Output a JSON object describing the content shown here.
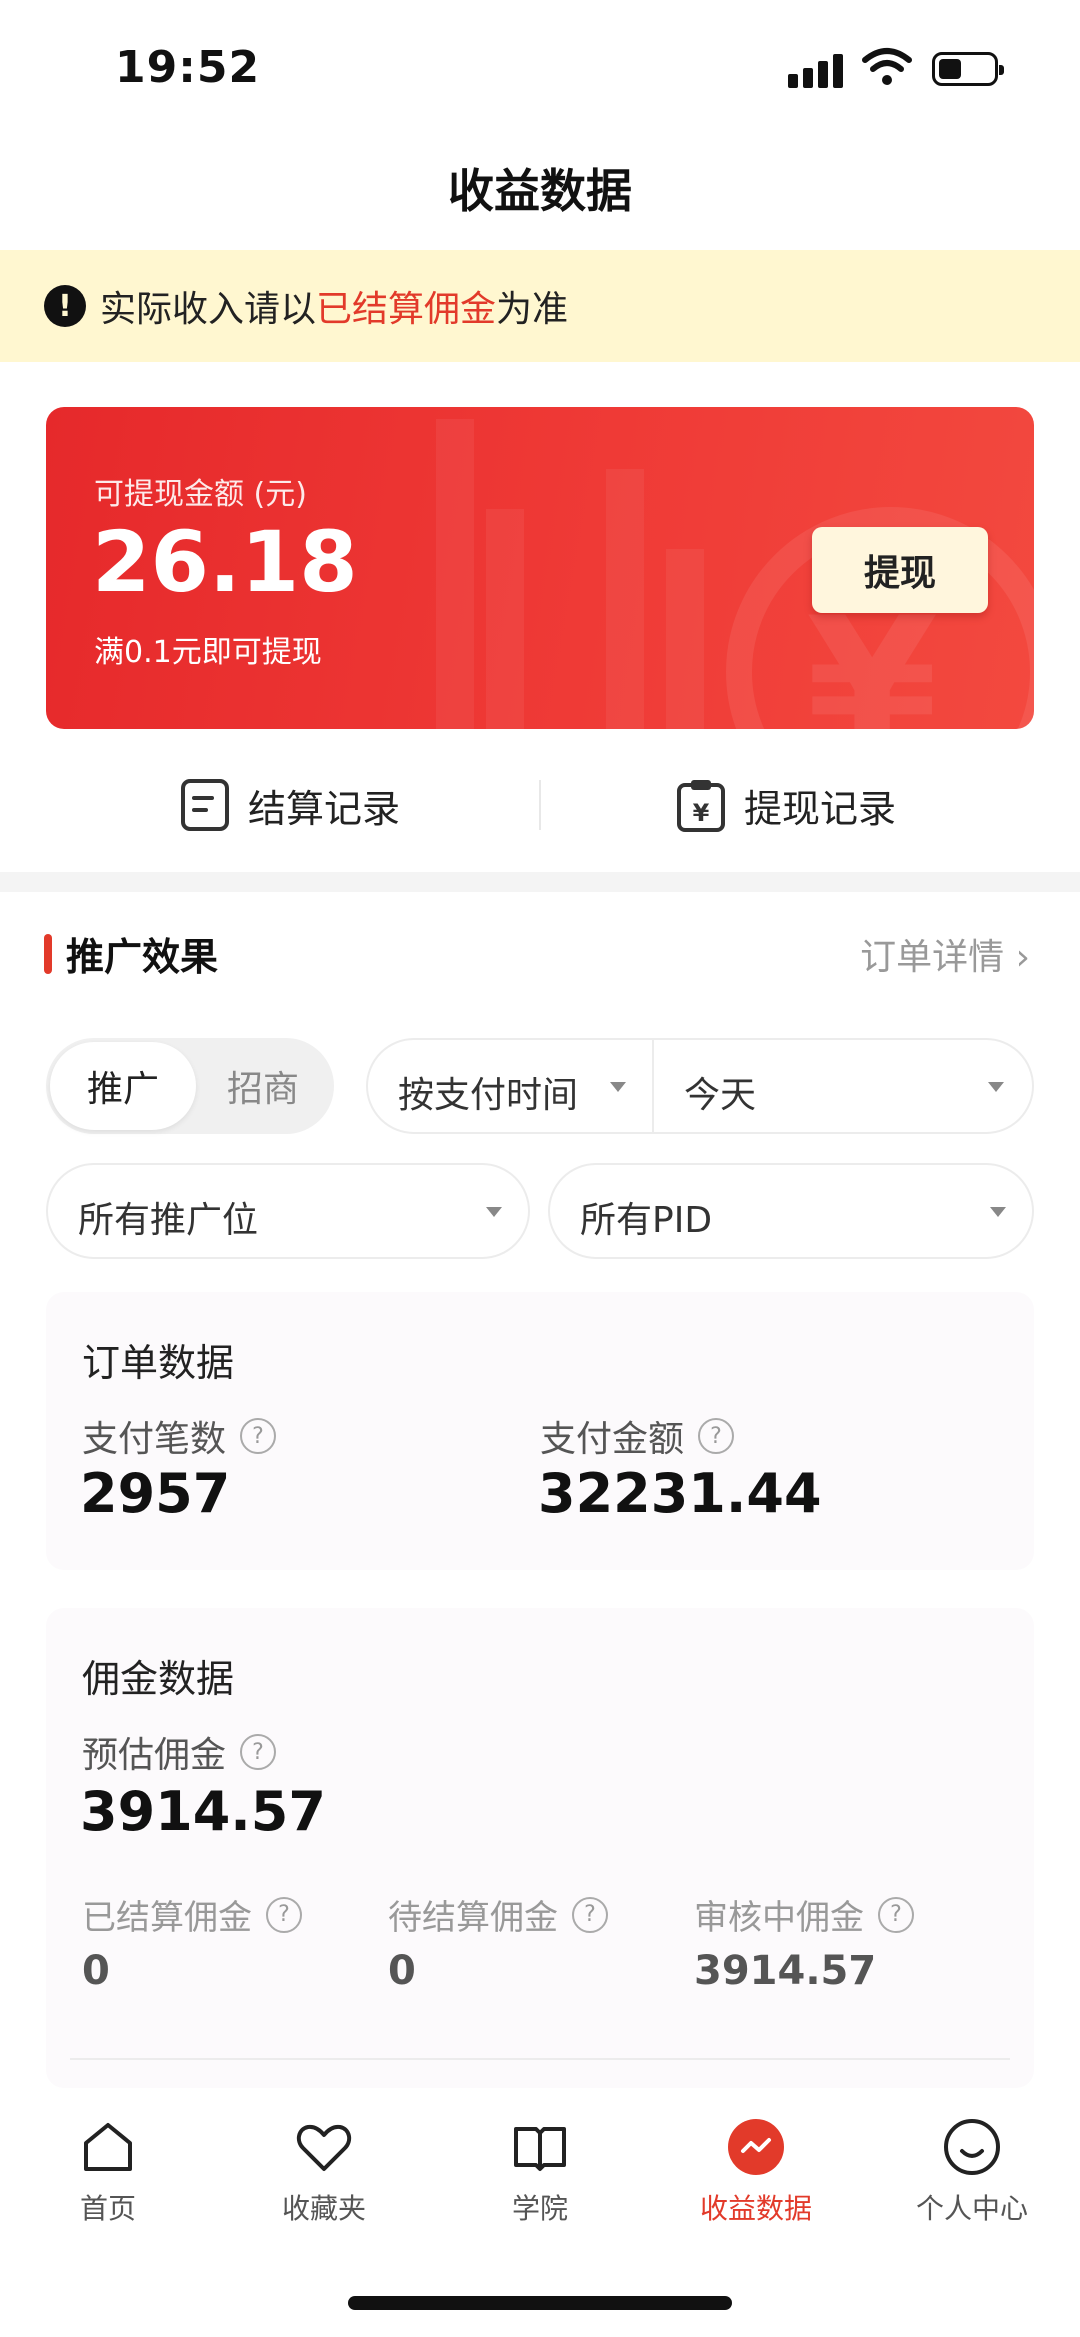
{
  "status_bar": {
    "time": "19:52"
  },
  "header": {
    "title": "收益数据"
  },
  "notice": {
    "prefix": "实际收入请以",
    "highlight": "已结算佣金",
    "suffix": "为准",
    "icon": "warning-icon"
  },
  "balance_card": {
    "label": "可提现金额 (元)",
    "amount": "26.18",
    "hint": "满0.1元即可提现",
    "withdraw_label": "提现"
  },
  "records": {
    "settle_label": "结算记录",
    "withdraw_label": "提现记录"
  },
  "section": {
    "title": "推广效果",
    "link": "订单详情"
  },
  "filters": {
    "segment": {
      "active": "推广",
      "inactive": "招商"
    },
    "time_basis": "按支付时间",
    "period": "今天",
    "slot": "所有推广位",
    "pid": "所有PID"
  },
  "order_data": {
    "title": "订单数据",
    "count_label": "支付笔数",
    "count_value": "2957",
    "amount_label": "支付金额",
    "amount_value": "32231.44"
  },
  "commission_data": {
    "title": "佣金数据",
    "estimate_label": "预估佣金",
    "estimate_value": "3914.57",
    "settled_label": "已结算佣金",
    "settled_value": "0",
    "pending_label": "待结算佣金",
    "pending_value": "0",
    "review_label": "审核中佣金",
    "review_value": "3914.57"
  },
  "tabbar": {
    "items": [
      {
        "label": "首页",
        "icon": "home-icon"
      },
      {
        "label": "收藏夹",
        "icon": "heart-icon"
      },
      {
        "label": "学院",
        "icon": "book-icon"
      },
      {
        "label": "收益数据",
        "icon": "earnings-icon"
      },
      {
        "label": "个人中心",
        "icon": "profile-icon"
      }
    ],
    "active_index": 3
  },
  "colors": {
    "accent": "#e23a2a",
    "notice_bg": "#fff7d0",
    "card_red": "#ec3431"
  }
}
